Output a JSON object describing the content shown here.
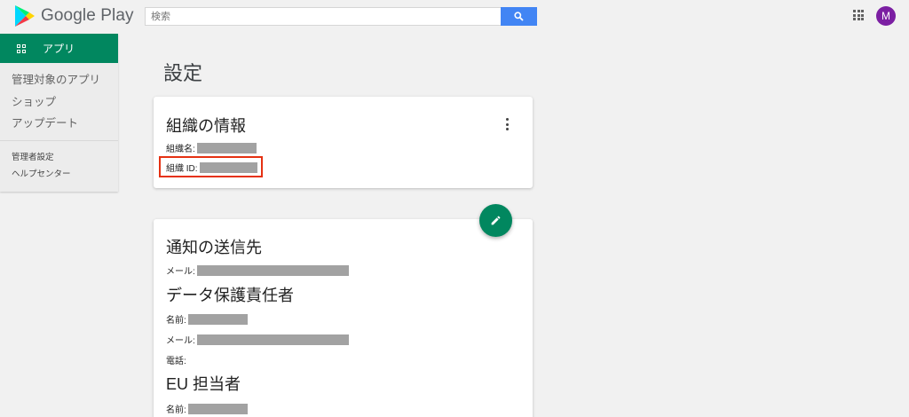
{
  "header": {
    "logo_text": "Google Play",
    "search_placeholder": "検索",
    "avatar_initial": "M"
  },
  "sidebar": {
    "active_item": "アプリ",
    "links": [
      "管理対象のアプリ",
      "ショップ",
      "アップデート"
    ],
    "admin_links": [
      "管理者設定",
      "ヘルプセンター"
    ]
  },
  "page": {
    "title": "設定"
  },
  "org_card": {
    "heading": "組織の情報",
    "name_label": "組織名:",
    "id_label": "組織 ID:"
  },
  "contacts_card": {
    "notification_heading": "通知の送信先",
    "notification_email_label": "メール:",
    "dpo_heading": "データ保護責任者",
    "dpo_name_label": "名前:",
    "dpo_email_label": "メール:",
    "dpo_phone_label": "電話:",
    "eu_heading": "EU 担当者",
    "eu_name_label": "名前:"
  },
  "colors": {
    "brand_green": "#01875f",
    "search_blue": "#4285f4",
    "avatar_purple": "#7b1fa2",
    "highlight_red": "#e53112"
  }
}
